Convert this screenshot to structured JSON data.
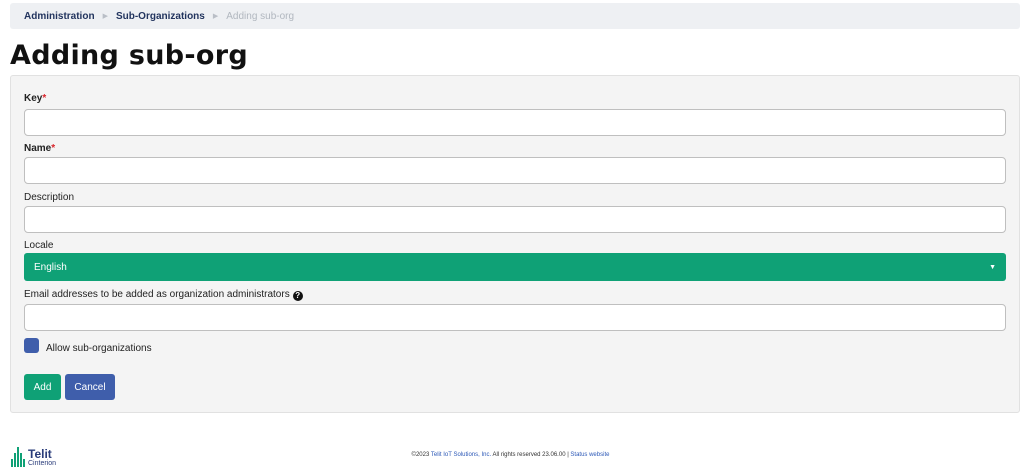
{
  "breadcrumb": {
    "items": [
      "Administration",
      "Sub-Organizations"
    ],
    "current": "Adding sub-org"
  },
  "page": {
    "title": "Adding sub-org"
  },
  "form": {
    "key_label": "Key",
    "name_label": "Name",
    "required_mark": "*",
    "description_label": "Description",
    "locale_label": "Locale",
    "locale_value": "English",
    "emails_label": "Email addresses to be added as organization administrators",
    "help_glyph": "?",
    "allow_suborgs_label": "Allow sub-organizations",
    "add_label": "Add",
    "cancel_label": "Cancel"
  },
  "footer": {
    "copyright_prefix": "©2023",
    "company": "Telit IoT Solutions, Inc.",
    "rights": "All rights reserved 23.06.00 |",
    "status_link": "Status website"
  },
  "logo": {
    "main": "Telit",
    "sub": "Cinterion"
  },
  "colors": {
    "primary_green": "#0fa176",
    "primary_blue": "#3f5eab",
    "required_red": "#d9262c",
    "link_blue": "#2c58b7"
  },
  "icons": {
    "breadcrumb_separator": "triangle-right-icon",
    "select_caret": "caret-down-icon",
    "help": "question-circle-icon"
  }
}
